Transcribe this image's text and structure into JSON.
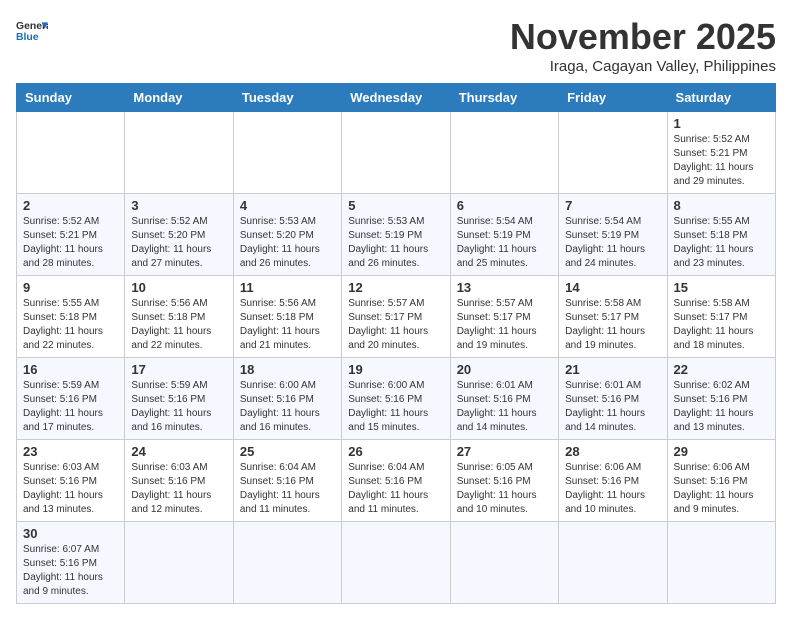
{
  "header": {
    "logo_general": "General",
    "logo_blue": "Blue",
    "month_title": "November 2025",
    "location": "Iraga, Cagayan Valley, Philippines"
  },
  "days_of_week": [
    "Sunday",
    "Monday",
    "Tuesday",
    "Wednesday",
    "Thursday",
    "Friday",
    "Saturday"
  ],
  "weeks": [
    [
      {
        "day": "",
        "sunrise": "",
        "sunset": "",
        "daylight": ""
      },
      {
        "day": "",
        "sunrise": "",
        "sunset": "",
        "daylight": ""
      },
      {
        "day": "",
        "sunrise": "",
        "sunset": "",
        "daylight": ""
      },
      {
        "day": "",
        "sunrise": "",
        "sunset": "",
        "daylight": ""
      },
      {
        "day": "",
        "sunrise": "",
        "sunset": "",
        "daylight": ""
      },
      {
        "day": "",
        "sunrise": "",
        "sunset": "",
        "daylight": ""
      },
      {
        "day": "1",
        "sunrise": "Sunrise: 5:52 AM",
        "sunset": "Sunset: 5:21 PM",
        "daylight": "Daylight: 11 hours and 29 minutes."
      }
    ],
    [
      {
        "day": "2",
        "sunrise": "Sunrise: 5:52 AM",
        "sunset": "Sunset: 5:21 PM",
        "daylight": "Daylight: 11 hours and 28 minutes."
      },
      {
        "day": "3",
        "sunrise": "Sunrise: 5:52 AM",
        "sunset": "Sunset: 5:20 PM",
        "daylight": "Daylight: 11 hours and 27 minutes."
      },
      {
        "day": "4",
        "sunrise": "Sunrise: 5:53 AM",
        "sunset": "Sunset: 5:20 PM",
        "daylight": "Daylight: 11 hours and 26 minutes."
      },
      {
        "day": "5",
        "sunrise": "Sunrise: 5:53 AM",
        "sunset": "Sunset: 5:19 PM",
        "daylight": "Daylight: 11 hours and 26 minutes."
      },
      {
        "day": "6",
        "sunrise": "Sunrise: 5:54 AM",
        "sunset": "Sunset: 5:19 PM",
        "daylight": "Daylight: 11 hours and 25 minutes."
      },
      {
        "day": "7",
        "sunrise": "Sunrise: 5:54 AM",
        "sunset": "Sunset: 5:19 PM",
        "daylight": "Daylight: 11 hours and 24 minutes."
      },
      {
        "day": "8",
        "sunrise": "Sunrise: 5:55 AM",
        "sunset": "Sunset: 5:18 PM",
        "daylight": "Daylight: 11 hours and 23 minutes."
      }
    ],
    [
      {
        "day": "9",
        "sunrise": "Sunrise: 5:55 AM",
        "sunset": "Sunset: 5:18 PM",
        "daylight": "Daylight: 11 hours and 22 minutes."
      },
      {
        "day": "10",
        "sunrise": "Sunrise: 5:56 AM",
        "sunset": "Sunset: 5:18 PM",
        "daylight": "Daylight: 11 hours and 22 minutes."
      },
      {
        "day": "11",
        "sunrise": "Sunrise: 5:56 AM",
        "sunset": "Sunset: 5:18 PM",
        "daylight": "Daylight: 11 hours and 21 minutes."
      },
      {
        "day": "12",
        "sunrise": "Sunrise: 5:57 AM",
        "sunset": "Sunset: 5:17 PM",
        "daylight": "Daylight: 11 hours and 20 minutes."
      },
      {
        "day": "13",
        "sunrise": "Sunrise: 5:57 AM",
        "sunset": "Sunset: 5:17 PM",
        "daylight": "Daylight: 11 hours and 19 minutes."
      },
      {
        "day": "14",
        "sunrise": "Sunrise: 5:58 AM",
        "sunset": "Sunset: 5:17 PM",
        "daylight": "Daylight: 11 hours and 19 minutes."
      },
      {
        "day": "15",
        "sunrise": "Sunrise: 5:58 AM",
        "sunset": "Sunset: 5:17 PM",
        "daylight": "Daylight: 11 hours and 18 minutes."
      }
    ],
    [
      {
        "day": "16",
        "sunrise": "Sunrise: 5:59 AM",
        "sunset": "Sunset: 5:16 PM",
        "daylight": "Daylight: 11 hours and 17 minutes."
      },
      {
        "day": "17",
        "sunrise": "Sunrise: 5:59 AM",
        "sunset": "Sunset: 5:16 PM",
        "daylight": "Daylight: 11 hours and 16 minutes."
      },
      {
        "day": "18",
        "sunrise": "Sunrise: 6:00 AM",
        "sunset": "Sunset: 5:16 PM",
        "daylight": "Daylight: 11 hours and 16 minutes."
      },
      {
        "day": "19",
        "sunrise": "Sunrise: 6:00 AM",
        "sunset": "Sunset: 5:16 PM",
        "daylight": "Daylight: 11 hours and 15 minutes."
      },
      {
        "day": "20",
        "sunrise": "Sunrise: 6:01 AM",
        "sunset": "Sunset: 5:16 PM",
        "daylight": "Daylight: 11 hours and 14 minutes."
      },
      {
        "day": "21",
        "sunrise": "Sunrise: 6:01 AM",
        "sunset": "Sunset: 5:16 PM",
        "daylight": "Daylight: 11 hours and 14 minutes."
      },
      {
        "day": "22",
        "sunrise": "Sunrise: 6:02 AM",
        "sunset": "Sunset: 5:16 PM",
        "daylight": "Daylight: 11 hours and 13 minutes."
      }
    ],
    [
      {
        "day": "23",
        "sunrise": "Sunrise: 6:03 AM",
        "sunset": "Sunset: 5:16 PM",
        "daylight": "Daylight: 11 hours and 13 minutes."
      },
      {
        "day": "24",
        "sunrise": "Sunrise: 6:03 AM",
        "sunset": "Sunset: 5:16 PM",
        "daylight": "Daylight: 11 hours and 12 minutes."
      },
      {
        "day": "25",
        "sunrise": "Sunrise: 6:04 AM",
        "sunset": "Sunset: 5:16 PM",
        "daylight": "Daylight: 11 hours and 11 minutes."
      },
      {
        "day": "26",
        "sunrise": "Sunrise: 6:04 AM",
        "sunset": "Sunset: 5:16 PM",
        "daylight": "Daylight: 11 hours and 11 minutes."
      },
      {
        "day": "27",
        "sunrise": "Sunrise: 6:05 AM",
        "sunset": "Sunset: 5:16 PM",
        "daylight": "Daylight: 11 hours and 10 minutes."
      },
      {
        "day": "28",
        "sunrise": "Sunrise: 6:06 AM",
        "sunset": "Sunset: 5:16 PM",
        "daylight": "Daylight: 11 hours and 10 minutes."
      },
      {
        "day": "29",
        "sunrise": "Sunrise: 6:06 AM",
        "sunset": "Sunset: 5:16 PM",
        "daylight": "Daylight: 11 hours and 9 minutes."
      }
    ],
    [
      {
        "day": "30",
        "sunrise": "Sunrise: 6:07 AM",
        "sunset": "Sunset: 5:16 PM",
        "daylight": "Daylight: 11 hours and 9 minutes."
      },
      {
        "day": "",
        "sunrise": "",
        "sunset": "",
        "daylight": ""
      },
      {
        "day": "",
        "sunrise": "",
        "sunset": "",
        "daylight": ""
      },
      {
        "day": "",
        "sunrise": "",
        "sunset": "",
        "daylight": ""
      },
      {
        "day": "",
        "sunrise": "",
        "sunset": "",
        "daylight": ""
      },
      {
        "day": "",
        "sunrise": "",
        "sunset": "",
        "daylight": ""
      },
      {
        "day": "",
        "sunrise": "",
        "sunset": "",
        "daylight": ""
      }
    ]
  ]
}
